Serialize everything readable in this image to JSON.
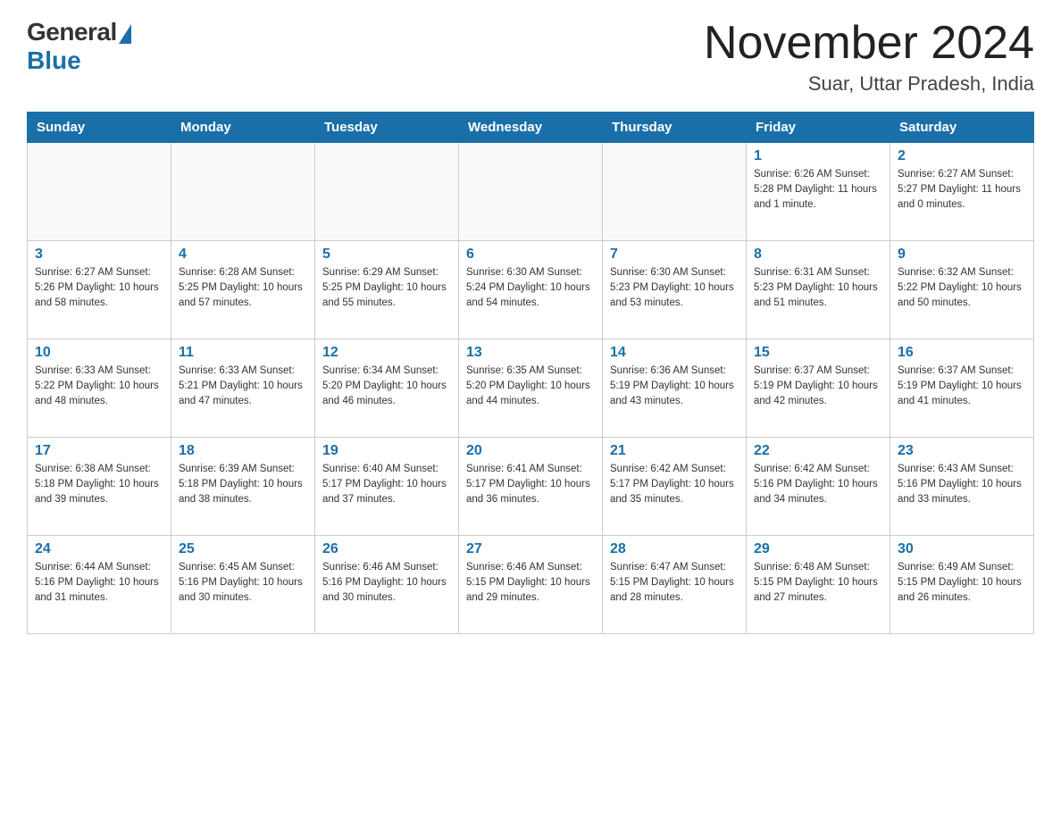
{
  "logo": {
    "general": "General",
    "blue": "Blue"
  },
  "header": {
    "month": "November 2024",
    "location": "Suar, Uttar Pradesh, India"
  },
  "days_of_week": [
    "Sunday",
    "Monday",
    "Tuesday",
    "Wednesday",
    "Thursday",
    "Friday",
    "Saturday"
  ],
  "weeks": [
    [
      {
        "day": "",
        "info": ""
      },
      {
        "day": "",
        "info": ""
      },
      {
        "day": "",
        "info": ""
      },
      {
        "day": "",
        "info": ""
      },
      {
        "day": "",
        "info": ""
      },
      {
        "day": "1",
        "info": "Sunrise: 6:26 AM\nSunset: 5:28 PM\nDaylight: 11 hours and 1 minute."
      },
      {
        "day": "2",
        "info": "Sunrise: 6:27 AM\nSunset: 5:27 PM\nDaylight: 11 hours and 0 minutes."
      }
    ],
    [
      {
        "day": "3",
        "info": "Sunrise: 6:27 AM\nSunset: 5:26 PM\nDaylight: 10 hours and 58 minutes."
      },
      {
        "day": "4",
        "info": "Sunrise: 6:28 AM\nSunset: 5:25 PM\nDaylight: 10 hours and 57 minutes."
      },
      {
        "day": "5",
        "info": "Sunrise: 6:29 AM\nSunset: 5:25 PM\nDaylight: 10 hours and 55 minutes."
      },
      {
        "day": "6",
        "info": "Sunrise: 6:30 AM\nSunset: 5:24 PM\nDaylight: 10 hours and 54 minutes."
      },
      {
        "day": "7",
        "info": "Sunrise: 6:30 AM\nSunset: 5:23 PM\nDaylight: 10 hours and 53 minutes."
      },
      {
        "day": "8",
        "info": "Sunrise: 6:31 AM\nSunset: 5:23 PM\nDaylight: 10 hours and 51 minutes."
      },
      {
        "day": "9",
        "info": "Sunrise: 6:32 AM\nSunset: 5:22 PM\nDaylight: 10 hours and 50 minutes."
      }
    ],
    [
      {
        "day": "10",
        "info": "Sunrise: 6:33 AM\nSunset: 5:22 PM\nDaylight: 10 hours and 48 minutes."
      },
      {
        "day": "11",
        "info": "Sunrise: 6:33 AM\nSunset: 5:21 PM\nDaylight: 10 hours and 47 minutes."
      },
      {
        "day": "12",
        "info": "Sunrise: 6:34 AM\nSunset: 5:20 PM\nDaylight: 10 hours and 46 minutes."
      },
      {
        "day": "13",
        "info": "Sunrise: 6:35 AM\nSunset: 5:20 PM\nDaylight: 10 hours and 44 minutes."
      },
      {
        "day": "14",
        "info": "Sunrise: 6:36 AM\nSunset: 5:19 PM\nDaylight: 10 hours and 43 minutes."
      },
      {
        "day": "15",
        "info": "Sunrise: 6:37 AM\nSunset: 5:19 PM\nDaylight: 10 hours and 42 minutes."
      },
      {
        "day": "16",
        "info": "Sunrise: 6:37 AM\nSunset: 5:19 PM\nDaylight: 10 hours and 41 minutes."
      }
    ],
    [
      {
        "day": "17",
        "info": "Sunrise: 6:38 AM\nSunset: 5:18 PM\nDaylight: 10 hours and 39 minutes."
      },
      {
        "day": "18",
        "info": "Sunrise: 6:39 AM\nSunset: 5:18 PM\nDaylight: 10 hours and 38 minutes."
      },
      {
        "day": "19",
        "info": "Sunrise: 6:40 AM\nSunset: 5:17 PM\nDaylight: 10 hours and 37 minutes."
      },
      {
        "day": "20",
        "info": "Sunrise: 6:41 AM\nSunset: 5:17 PM\nDaylight: 10 hours and 36 minutes."
      },
      {
        "day": "21",
        "info": "Sunrise: 6:42 AM\nSunset: 5:17 PM\nDaylight: 10 hours and 35 minutes."
      },
      {
        "day": "22",
        "info": "Sunrise: 6:42 AM\nSunset: 5:16 PM\nDaylight: 10 hours and 34 minutes."
      },
      {
        "day": "23",
        "info": "Sunrise: 6:43 AM\nSunset: 5:16 PM\nDaylight: 10 hours and 33 minutes."
      }
    ],
    [
      {
        "day": "24",
        "info": "Sunrise: 6:44 AM\nSunset: 5:16 PM\nDaylight: 10 hours and 31 minutes."
      },
      {
        "day": "25",
        "info": "Sunrise: 6:45 AM\nSunset: 5:16 PM\nDaylight: 10 hours and 30 minutes."
      },
      {
        "day": "26",
        "info": "Sunrise: 6:46 AM\nSunset: 5:16 PM\nDaylight: 10 hours and 30 minutes."
      },
      {
        "day": "27",
        "info": "Sunrise: 6:46 AM\nSunset: 5:15 PM\nDaylight: 10 hours and 29 minutes."
      },
      {
        "day": "28",
        "info": "Sunrise: 6:47 AM\nSunset: 5:15 PM\nDaylight: 10 hours and 28 minutes."
      },
      {
        "day": "29",
        "info": "Sunrise: 6:48 AM\nSunset: 5:15 PM\nDaylight: 10 hours and 27 minutes."
      },
      {
        "day": "30",
        "info": "Sunrise: 6:49 AM\nSunset: 5:15 PM\nDaylight: 10 hours and 26 minutes."
      }
    ]
  ]
}
